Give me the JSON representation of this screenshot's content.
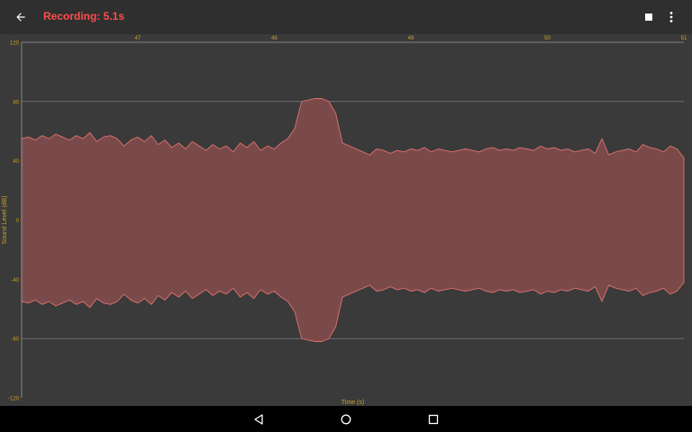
{
  "appbar": {
    "title": "Recording: 5.1s",
    "title_color": "#ff4d4d",
    "icons": {
      "back": "arrow-back-icon",
      "stop": "stop-icon",
      "menu": "more-vert-icon"
    }
  },
  "chart_data": {
    "type": "area",
    "title": "",
    "xlabel": "Time (s)",
    "ylabel": "Sound Level (dB)",
    "ylim": [
      -120,
      120
    ],
    "yticks": [
      120,
      80,
      40,
      0,
      -40,
      -80,
      -120
    ],
    "xlim": [
      46.15,
      51.0
    ],
    "xticks": [
      47,
      48,
      49,
      50,
      51
    ],
    "grid": true,
    "fill_color": "#7a4a4a",
    "line_color": "#e07070",
    "series": [
      {
        "x": [
          46.15,
          46.2,
          46.25,
          46.3,
          46.35,
          46.4,
          46.45,
          46.5,
          46.55,
          46.6,
          46.65,
          46.7,
          46.75,
          46.8,
          46.85,
          46.9,
          46.95,
          47.0,
          47.05,
          47.1,
          47.15,
          47.2,
          47.25,
          47.3,
          47.35,
          47.4,
          47.45,
          47.5,
          47.55,
          47.6,
          47.65,
          47.7,
          47.75,
          47.8,
          47.85,
          47.9,
          47.95,
          48.0,
          48.05,
          48.1,
          48.15,
          48.2,
          48.25,
          48.3,
          48.35,
          48.4,
          48.45,
          48.5,
          48.55,
          48.6,
          48.65,
          48.7,
          48.75,
          48.8,
          48.85,
          48.9,
          48.95,
          49.0,
          49.05,
          49.1,
          49.15,
          49.2,
          49.25,
          49.3,
          49.35,
          49.4,
          49.45,
          49.5,
          49.55,
          49.6,
          49.65,
          49.7,
          49.75,
          49.8,
          49.85,
          49.9,
          49.95,
          50.0,
          50.05,
          50.1,
          50.15,
          50.2,
          50.25,
          50.3,
          50.35,
          50.4,
          50.45,
          50.5,
          50.55,
          50.6,
          50.65,
          50.7,
          50.75,
          50.8,
          50.85,
          50.9,
          50.95,
          51.0
        ],
        "values": [
          55,
          56,
          54,
          57,
          55,
          58,
          56,
          54,
          57,
          55,
          59,
          53,
          56,
          57,
          55,
          50,
          54,
          56,
          53,
          57,
          51,
          54,
          49,
          52,
          48,
          53,
          50,
          47,
          51,
          48,
          50,
          46,
          52,
          49,
          53,
          47,
          50,
          48,
          52,
          55,
          62,
          80,
          81,
          82,
          82,
          80,
          72,
          52,
          50,
          48,
          46,
          44,
          48,
          47,
          45,
          47,
          46,
          48,
          47,
          49,
          46,
          48,
          47,
          46,
          47,
          48,
          47,
          46,
          48,
          49,
          47,
          48,
          47,
          49,
          48,
          47,
          50,
          48,
          49,
          47,
          48,
          46,
          47,
          48,
          45,
          55,
          44,
          46,
          47,
          48,
          46,
          51,
          49,
          48,
          46,
          50,
          48,
          42
        ]
      }
    ]
  },
  "navbar": {
    "icons": {
      "back": "nav-back-icon",
      "home": "nav-home-icon",
      "recents": "nav-recents-icon"
    }
  }
}
